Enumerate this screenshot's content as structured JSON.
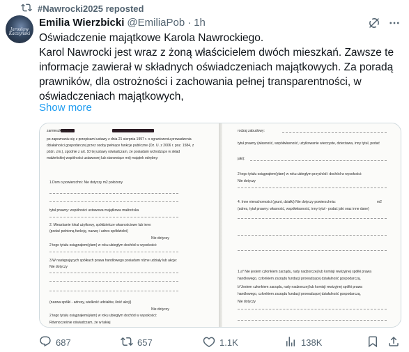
{
  "repost": {
    "label": "#Nawrocki2025 reposted"
  },
  "author": {
    "avatar_caption": "Jarosław Kaczyński",
    "name": "Emilia Wierzbicki",
    "handle": "@EmiliaPob",
    "separator": "·",
    "time": "1h"
  },
  "tweet": {
    "lines": [
      "Oświadczenie majątkowe Karola Nawrockiego.",
      "Karol Nawrocki jest wraz z żoną właścicielem dwóch mieszkań. Zawsze te",
      "informacje zawierał w składnych oświadczeniach majątkowych. Za poradą",
      "prawników,  dla ostrożności i zachowania pełnej transparentności, w",
      "oświadczeniach majątkowych,"
    ],
    "show_more": "Show more"
  },
  "document": {
    "left_lines": [
      "zamieszkały/a w",
      "po zapoznaniu się z przepisami ustawy z dnia 21 sierpnia 1997 r. o ograniczeniu prowadzenia",
      "działalności gospodarczej przez osoby pełniące funkcje publiczne (Dz. U. z 2006 r. poz. 1584, z",
      "późn. zm.), zgodnie z art. 10 tej ustawy oświadczam, że posiadam wchodzące w skład",
      "małżeńskiej wspólności ustawowej lub stanowiące mój majątek odrębny:",
      "1.Dom o powierzchni: Nie dotyczy   m2 położony",
      "tytuł prawny: współności ustawowa majątkowa małżeńska",
      "2. Mieszkanie lokal użytkowy, spółdzielcze własnościowe lub inne:",
      "(podać pełnioną funkcję, nazwę i adres spółdzielni)",
      "Nie dotyczy",
      "2 tego tytułu osiągnąłem(ęłam) w roku ubiegłym dochód w wysokości:",
      "3.W następujących spółkach prawa handlowego posiadam różne udziały lub akcje:",
      "Nie dotyczy",
      "(nazwa spółki - adresy, wielkość udziałów, ilość akcji)",
      "Nie dotyczy",
      "2 tego tytułu osiągnąłem(ęłam) w roku ubiegłym dochód w wysokości:",
      "Równocześnie oświadczam, że w takiej"
    ],
    "right_lines": [
      "rodzaj zabudowy:",
      "tytuł prawny (własność, współwłasność, użytkowanie wieczyste, dzierżawa, inny tytuł, podać",
      "jaki):",
      "2 tego tytułu osiągnąłem(ęłam) w roku ubiegłym przychód i dochód w wysokości:",
      "Nie dotyczy",
      "4. Inne nieruchomości (grunt, działki) Nie dotyczy powierzchnia:",
      "m2",
      "(adres, tytuł prawny: własność, współwłasność, inny tytuł - podać jaki oraz inne dane)",
      "1.a* Nie jestem członkiem zarządu, rady nadzorczej lub komisji rewizyjnej spółki prawa",
      "handlowego, członkiem zarządu fundacji prowadzącej działalność gospodarczą,",
      "b*Jestem członkiem zarządu, rady nadzorczej lub komisji rewizyjnej spółki prawa",
      "handlowego, członkiem zarządu fundacji prowadzącej działalność gospodarczą,",
      "Nie dotyczy"
    ]
  },
  "actions": {
    "replies": "687",
    "reposts": "657",
    "likes": "1.1K",
    "views": "138K"
  }
}
